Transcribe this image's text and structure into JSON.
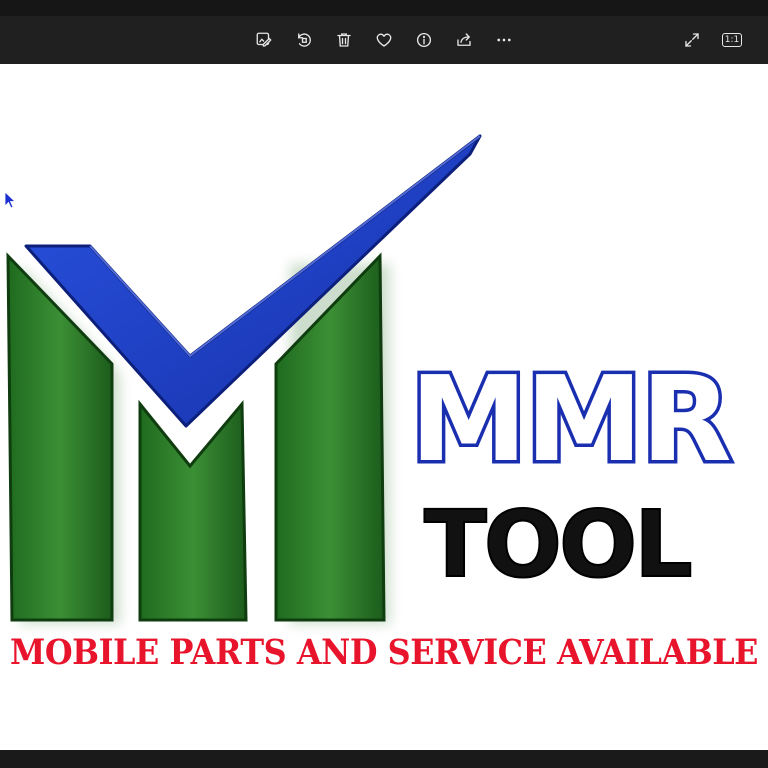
{
  "toolbar": {
    "buttons": [
      {
        "name": "edit-image",
        "icon": "edit-image-icon"
      },
      {
        "name": "rotate",
        "icon": "rotate-icon"
      },
      {
        "name": "delete",
        "icon": "trash-icon"
      },
      {
        "name": "favorite",
        "icon": "heart-icon"
      },
      {
        "name": "info",
        "icon": "info-icon"
      },
      {
        "name": "share",
        "icon": "share-icon"
      },
      {
        "name": "more",
        "icon": "more-icon"
      }
    ],
    "right_buttons": [
      {
        "name": "fullscreen",
        "icon": "expand-icon"
      },
      {
        "name": "actual-size",
        "icon": "actual-size-icon",
        "label": "1:1"
      }
    ]
  },
  "image": {
    "logo_line1": "MMR",
    "logo_line2": "TOOL",
    "tagline": "MOBILE PARTS AND SERVICE AVAILABLE",
    "colors": {
      "green": "#2e7d2a",
      "blue": "#1a3fc8",
      "red": "#e8142c",
      "black": "#111111"
    }
  }
}
